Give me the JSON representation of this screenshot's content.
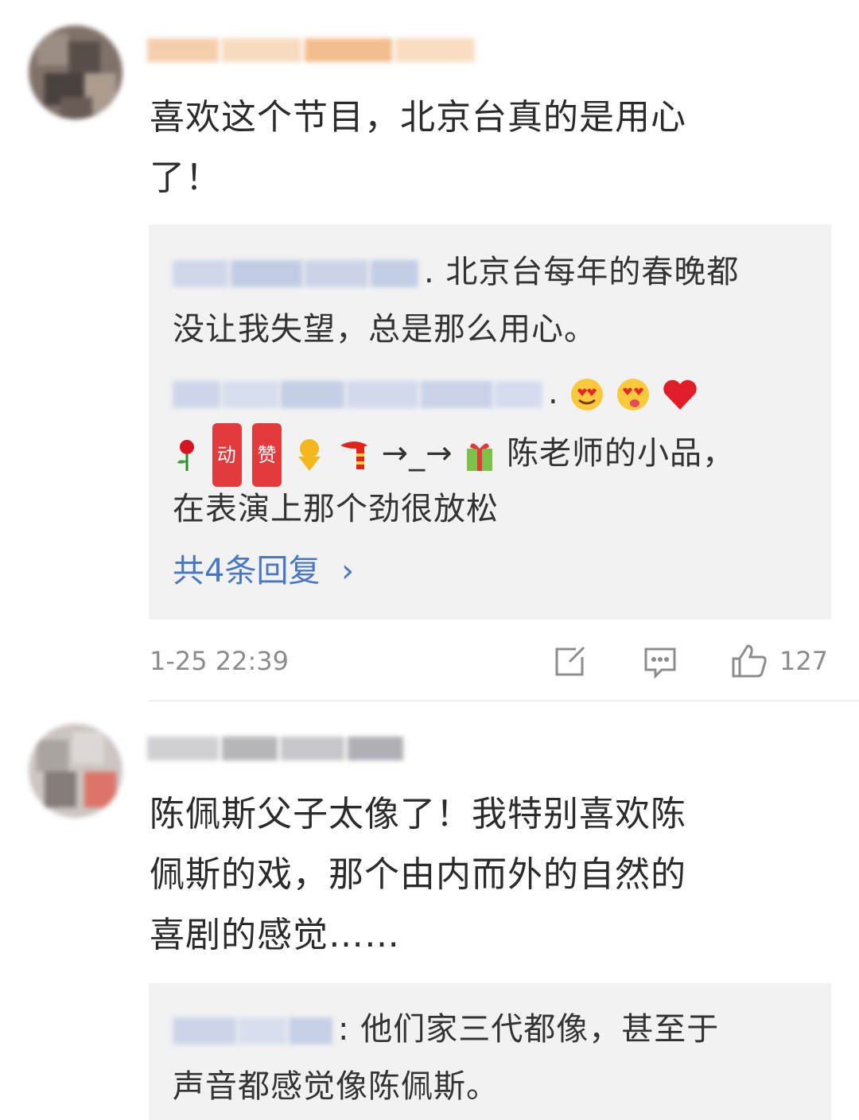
{
  "comments": [
    {
      "text_line1": "喜欢这个节目，北京台真的是用心",
      "text_line2": "了！",
      "reply_box": {
        "reply1_line1": ". 北京台每年的春晚都",
        "reply1_line2": "没让我失望，总是那么用心。",
        "reply2_suffix": ".",
        "reply2_line2_text": "→_→",
        "reply2_line2_text2": "陈老师的小品，",
        "reply2_line3": "在表演上那个劲很放松",
        "more_label": "共4条回复",
        "more_arrow": "›"
      },
      "timestamp": "1-25 22:39",
      "like_count": "127",
      "icons": {
        "share": "share-icon",
        "comment": "comment-icon",
        "like": "like-icon"
      }
    },
    {
      "text_line1": "陈佩斯父子太像了！我特别喜欢陈",
      "text_line2": "佩斯的戏，那个由内而外的自然的",
      "text_line3": "喜剧的感觉……",
      "reply_box": {
        "reply1_line1": ": 他们家三代都像，甚至于",
        "reply1_line2": "声音都感觉像陈佩斯。"
      }
    }
  ],
  "badges": {
    "badge1": "动",
    "badge2": "赞"
  },
  "colors": {
    "link": "#4a77c2",
    "reply_bg": "#f2f2f2",
    "meta": "#8c8c8c"
  }
}
